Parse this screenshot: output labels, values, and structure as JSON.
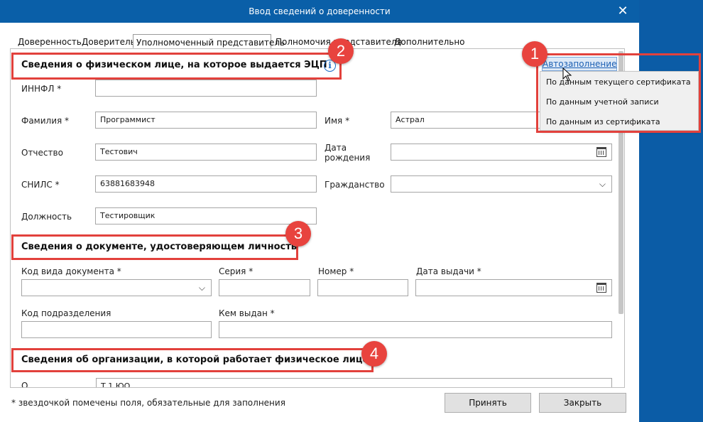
{
  "window": {
    "title": "Ввод сведений о доверенности",
    "close_glyph": "✕"
  },
  "tabs": [
    {
      "label": "Доверенность"
    },
    {
      "label": "Доверитель"
    },
    {
      "label": "Уполномоченный представитель"
    },
    {
      "label": "Полномочия представителя"
    },
    {
      "label": "Дополнительно"
    }
  ],
  "sections": {
    "person": "Сведения о физическом лице, на которое выдается ЭЦП",
    "document": "Сведения о документе, удостоверяющем личность",
    "organization": "Сведения об организации, в которой работает физическое лицо"
  },
  "info_glyph": "i",
  "person_fields": {
    "innfl": {
      "label": "ИННФЛ *",
      "value": ""
    },
    "surname": {
      "label": "Фамилия *",
      "value": "Программист"
    },
    "name": {
      "label": "Имя *",
      "value": "Астрал"
    },
    "patronymic": {
      "label": "Отчество",
      "value": "Тестович"
    },
    "birthdate": {
      "label_line1": "Дата",
      "label_line2": "рождения",
      "value": ""
    },
    "snils": {
      "label": "СНИЛС *",
      "value": "63881683948"
    },
    "citizenship": {
      "label": "Гражданство",
      "value": ""
    },
    "position": {
      "label": "Должность",
      "value": "Тестировщик"
    }
  },
  "document_fields": {
    "doc_type_code": {
      "label": "Код вида документа *",
      "value": ""
    },
    "series": {
      "label": "Серия *",
      "value": ""
    },
    "number": {
      "label": "Номер *",
      "value": ""
    },
    "issue_date": {
      "label": "Дата выдачи *",
      "value": ""
    },
    "department_code": {
      "label": "Код подразделения",
      "value": ""
    },
    "issued_by": {
      "label": "Кем выдан *",
      "value": ""
    }
  },
  "org_fields": {
    "partial_label": "О",
    "partial_value": "Т 1 ЮО"
  },
  "autofill": {
    "label": "Автозаполнение",
    "menu": [
      "По данным текущего сертификата",
      "По данным учетной записи",
      "По данным из сертификата"
    ]
  },
  "badges": [
    "1",
    "2",
    "3",
    "4"
  ],
  "footer": {
    "note": "* звездочкой помечены поля, обязательные для заполнения",
    "accept": "Принять",
    "close": "Закрыть"
  },
  "icons": {
    "dropdown": "chevron-down-icon",
    "calendar": "calendar-icon",
    "info": "info-icon",
    "cursor": "mouse-pointer-icon"
  },
  "colors": {
    "titlebar": "#0a5fa8",
    "highlight": "#e2413c",
    "badge": "#e8433e",
    "link": "#1b5fb3"
  }
}
